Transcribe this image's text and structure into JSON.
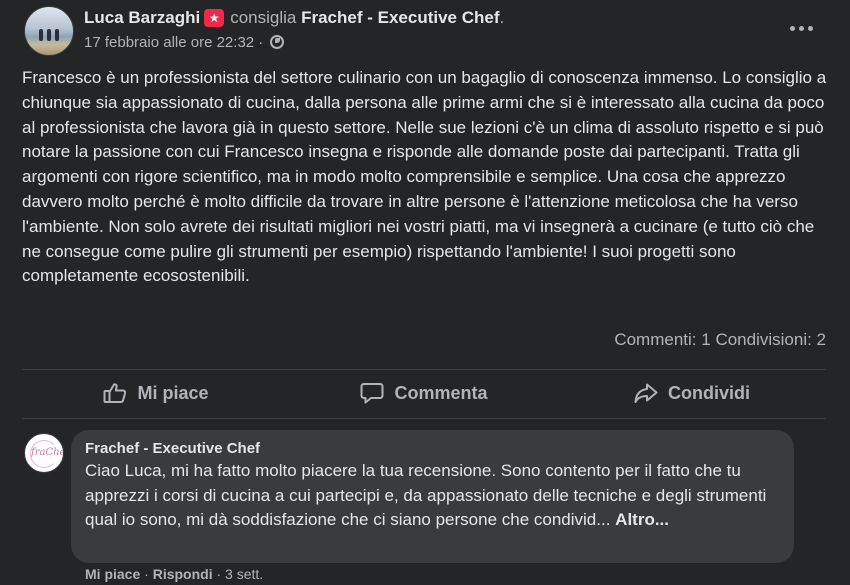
{
  "post": {
    "author": "Luca Barzaghi",
    "verb": "consiglia",
    "page": "Frachef - Executive Chef",
    "trailing_dot": ".",
    "date": "17 febbraio alle ore 22:32 ·",
    "badge_icon": "recommend-badge-icon",
    "text": "Francesco è un professionista del settore culinario con un bagaglio di conoscenza immenso. Lo consiglio a chiunque sia appassionato di cucina, dalla persona alle prime armi che si è interessato alla cucina da poco al professionista che lavora già in questo settore. Nelle sue lezioni c'è un clima di assoluto rispetto e si può notare la passione con cui Francesco insegna e risponde alle domande poste dai partecipanti. Tratta gli argomenti con rigore scientifico, ma in modo molto comprensibile e semplice. Una cosa che apprezzo davvero molto perché è molto difficile da trovare in altre persone è l'attenzione meticolosa che ha verso l'ambiente. Non solo avrete dei risultati migliori nei vostri piatti, ma vi insegnerà a cucinare (e tutto ciò che ne consegue come pulire gli strumenti per esempio) rispettando l'ambiente! I suoi progetti sono completamente ecosostenibili.",
    "comments_count": "Commenti: 1",
    "shares_count": "Condivisioni: 2"
  },
  "actions": {
    "like": "Mi piace",
    "comment": "Commenta",
    "share": "Condividi"
  },
  "comment": {
    "author": "Frachef - Executive Chef",
    "avatar_text": "fraChef",
    "text": "Ciao Luca, mi ha fatto molto piacere la tua recensione. Sono contento per il fatto che tu apprezzi i corsi di cucina a cui partecipi e, da appassionato delle tecniche e degli strumenti qual io sono, mi dà soddisfazione che ci siano persone che condivid...",
    "more": "Altro...",
    "like": "Mi piace",
    "reply": "Rispondi",
    "time": "3 sett.",
    "sep": "·"
  },
  "colors": {
    "background": "#242526",
    "bubble": "#3a3b3c",
    "primary_text": "#e4e6eb",
    "secondary_text": "#b0b3b8",
    "badge": "#f02849"
  }
}
